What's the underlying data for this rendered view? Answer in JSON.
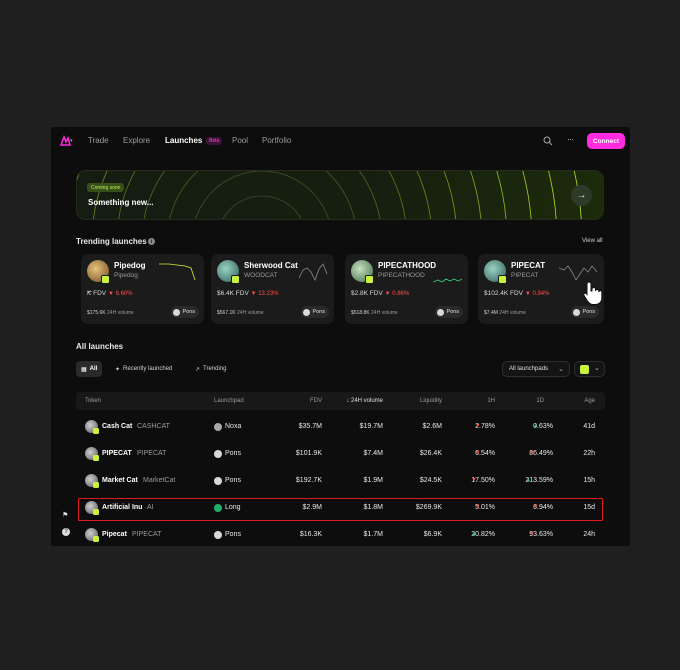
{
  "nav": {
    "items": [
      "Trade",
      "Explore",
      "Launches",
      "Pool",
      "Portfolio"
    ],
    "active": "Launches",
    "beta_label": "Beta",
    "connect_label": "Connect",
    "search_icon": "search-icon",
    "more_icon": "more-icon"
  },
  "hero": {
    "badge": "Coming soon",
    "title": "Something new...",
    "button_icon": "arrow-right-icon"
  },
  "trending": {
    "title": "Trending launches",
    "view_all": "View all",
    "cards": [
      {
        "name": "Pipedog",
        "ticker": "Pipedog",
        "fdv": "K FDV",
        "change": "▼ 6.60%",
        "volume": "$175.6K",
        "volume_label": "24H volume",
        "launchpad": "Pons"
      },
      {
        "name": "Sherwood Cat",
        "ticker": "WOODCAT",
        "fdv": "$6.4K FDV",
        "change": "▼ 13.23%",
        "volume": "$567.1K",
        "volume_label": "24H volume",
        "launchpad": "Pons"
      },
      {
        "name": "PIPECATHOOD",
        "ticker": "PIPECATHOOD",
        "fdv": "$2.8K FDV",
        "change": "▼ 0.86%",
        "volume": "$518.8K",
        "volume_label": "24H volume",
        "launchpad": "Pons"
      },
      {
        "name": "PIPECAT",
        "ticker": "PIPECAT",
        "fdv": "$102.4K FDV",
        "change": "▼ 0.84%",
        "volume": "$7.4M",
        "volume_label": "24H volume",
        "launchpad": "Pons"
      }
    ]
  },
  "all_launches": {
    "title": "All launches",
    "filters": [
      "All",
      "Recently launched",
      "Trending"
    ],
    "launchpad_select": "All launchpads",
    "columns": [
      "Token",
      "Launchpad",
      "FDV",
      "↓ 24H volume",
      "Liquidity",
      "1H",
      "1D",
      "Age"
    ],
    "rows": [
      {
        "name": "Cash Cat",
        "ticker": "CASHCAT",
        "launchpad": "Noxa",
        "fdv": "$35.7M",
        "volume": "$19.7M",
        "liquidity": "$2.6M",
        "h1_dir": "down",
        "h1": "2.78%",
        "d1_dir": "up",
        "d1": "0.63%",
        "age": "41d"
      },
      {
        "name": "PIPECAT",
        "ticker": "PIPECAT",
        "launchpad": "Pons",
        "fdv": "$101.9K",
        "volume": "$7.4M",
        "liquidity": "$26.4K",
        "h1_dir": "down",
        "h1": "6.54%",
        "d1_dir": "down",
        "d1": "86.49%",
        "age": "22h"
      },
      {
        "name": "Market Cat",
        "ticker": "MarketCat",
        "launchpad": "Pons",
        "fdv": "$192.7K",
        "volume": "$1.9M",
        "liquidity": "$24.5K",
        "h1_dir": "down",
        "h1": "17.50%",
        "d1_dir": "up",
        "d1": "213.59%",
        "age": "15h"
      },
      {
        "name": "Artificial Inu",
        "ticker": "AI",
        "launchpad": "Long",
        "fdv": "$2.9M",
        "volume": "$1.8M",
        "liquidity": "$269.9K",
        "h1_dir": "down",
        "h1": "5.01%",
        "d1_dir": "down",
        "d1": "6.94%",
        "age": "15d"
      },
      {
        "name": "Pipecat",
        "ticker": "PIPECAT",
        "launchpad": "Pons",
        "fdv": "$16.3K",
        "volume": "$1.7M",
        "liquidity": "$6.9K",
        "h1_dir": "up",
        "h1": "20.82%",
        "d1_dir": "down",
        "d1": "93.63%",
        "age": "24h"
      }
    ],
    "highlighted_row": 3
  },
  "colors": {
    "accent": "#ff2be0",
    "brand_green": "#c9f23e",
    "positive": "#33d17a",
    "negative": "#ff4d4d",
    "highlight_border": "#e01b1b"
  }
}
